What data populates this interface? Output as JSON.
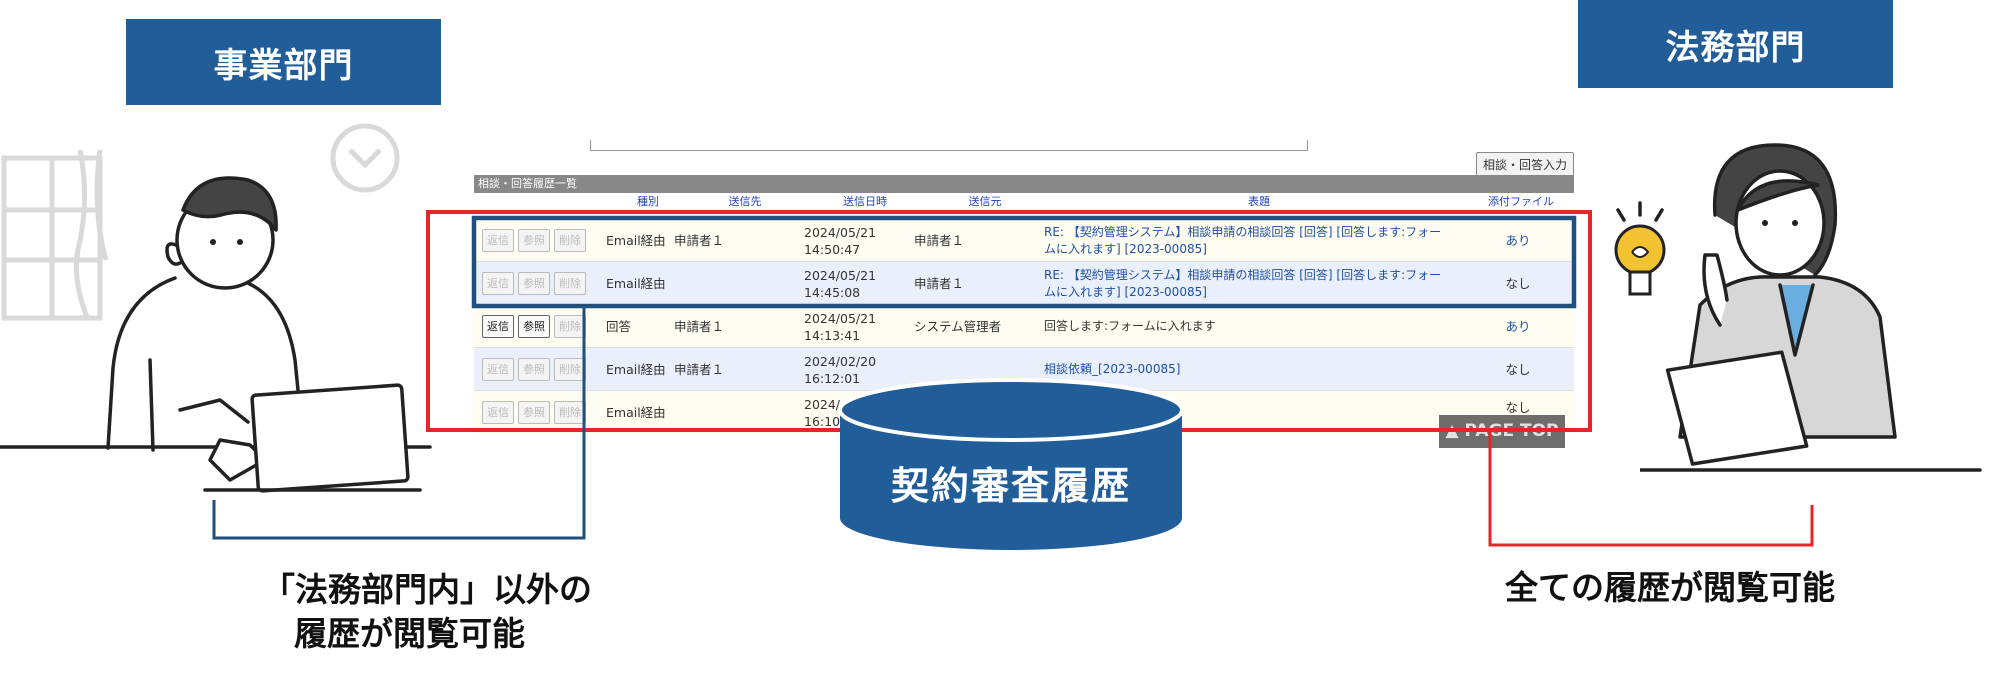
{
  "left_panel": {
    "dept_label": "事業部門",
    "caption_line1": "「法務部門内」以外の",
    "caption_line2": "履歴が閲覧可能"
  },
  "right_panel": {
    "dept_label": "法務部門",
    "caption": "全ての履歴が閲覧可能"
  },
  "database_label": "契約審査履歴",
  "history": {
    "consult_button": "相談・回答入力",
    "header": "相談・回答履歴一覧",
    "columns": [
      "種別",
      "送信先",
      "送信日時",
      "送信元",
      "表題",
      "添付ファイル"
    ],
    "buttons": {
      "reply": "返信",
      "view": "参照",
      "delete": "削除"
    },
    "rows": [
      {
        "type": "Email経由",
        "to": "申請者１",
        "date": "2024/05/21",
        "time": "14:50:47",
        "from": "申請者１",
        "subject_1": "RE: 【契約管理システム】相談申請の相談回答 [回答] [回答します:フォー",
        "subject_2": "ムに入れます] [2023-00085]",
        "attach": "あり"
      },
      {
        "type": "Email経由",
        "to": "",
        "date": "2024/05/21",
        "time": "14:45:08",
        "from": "申請者１",
        "subject_1": "RE: 【契約管理システム】相談申請の相談回答 [回答] [回答します:フォー",
        "subject_2": "ムに入れます] [2023-00085]",
        "attach": "なし"
      },
      {
        "type": "回答",
        "to": "申請者１",
        "date": "2024/05/21",
        "time": "14:13:41",
        "from": "システム管理者",
        "subject_1": "回答します:フォームに入れます",
        "subject_2": "",
        "attach": "あり"
      },
      {
        "type": "Email経由",
        "to": "申請者１",
        "date": "2024/02/20",
        "time": "16:12:01",
        "from": "",
        "subject_1": "相談依頼_[2023-00085]",
        "subject_2": "",
        "attach": "なし"
      },
      {
        "type": "Email経由",
        "to": "",
        "date": "2024/",
        "time": "16:10",
        "from": "",
        "subject_1": "",
        "subject_2": "",
        "attach": "なし"
      }
    ],
    "page_top": "▲ PAGE TOP"
  },
  "colors": {
    "dept_blue": "#215d99",
    "highlight_red": "#e8232a",
    "highlight_navy": "#1f4f7d"
  }
}
